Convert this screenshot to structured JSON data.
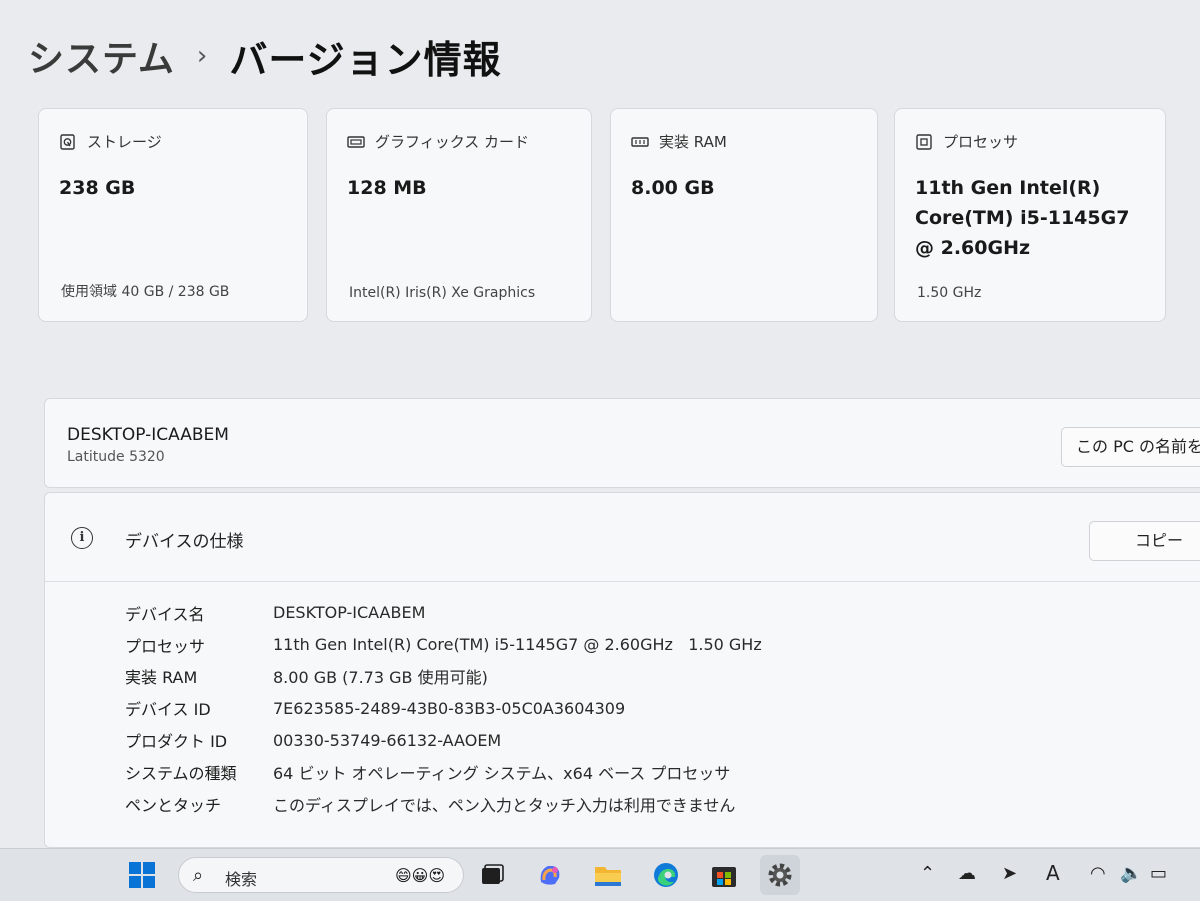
{
  "breadcrumb": {
    "parent": "システム",
    "separator": "›",
    "title": "バージョン情報"
  },
  "cards": [
    {
      "label": "ストレージ",
      "icon": "storage-icon",
      "value": "238 GB",
      "sub": "使用領域 40 GB / 238 GB"
    },
    {
      "label": "グラフィックス カード",
      "icon": "gpu-icon",
      "value": "128 MB",
      "sub": "Intel(R) Iris(R) Xe Graphics"
    },
    {
      "label": "実装 RAM",
      "icon": "ram-icon",
      "value": "8.00 GB",
      "sub": ""
    },
    {
      "label": "プロセッサ",
      "icon": "processor-icon",
      "value": "11th Gen Intel(R) Core(TM) i5-1145G7 @ 2.60GHz",
      "sub": "1.50 GHz"
    }
  ],
  "device": {
    "name": "DESKTOP-ICAABEM",
    "model": "Latitude 5320",
    "rename_label": "この PC の名前を"
  },
  "specs": {
    "title": "デバイスの仕様",
    "copy_label": "コピー",
    "rows": [
      {
        "key": "デバイス名",
        "value": "DESKTOP-ICAABEM"
      },
      {
        "key": "プロセッサ",
        "value": "11th Gen Intel(R) Core(TM) i5-1145G7 @ 2.60GHz   1.50 GHz"
      },
      {
        "key": "実装 RAM",
        "value": "8.00 GB (7.73 GB 使用可能)"
      },
      {
        "key": "デバイス ID",
        "value": "7E623585-2489-43B0-83B3-05C0A3604309"
      },
      {
        "key": "プロダクト ID",
        "value": "00330-53749-66132-AAOEM"
      },
      {
        "key": "システムの種類",
        "value": "64 ビット オペレーティング システム、x64 ベース プロセッサ"
      },
      {
        "key": "ペンとタッチ",
        "value": "このディスプレイでは、ペン入力とタッチ入力は利用できません"
      }
    ]
  },
  "taskbar": {
    "search_placeholder": "検索",
    "apps": [
      "start-icon",
      "task-view-icon",
      "copilot-icon",
      "file-explorer-icon",
      "edge-icon",
      "store-icon",
      "settings-icon"
    ],
    "tray": [
      "chevron-up-icon",
      "cloud-icon",
      "location-icon",
      "ime-indicator",
      "wifi-icon",
      "volume-icon",
      "battery-icon"
    ],
    "ime": "A"
  },
  "colors": {
    "background": "#e9ebee",
    "card": "#f7f8f9",
    "taskbar": "#dfe3e8",
    "accent": "#0067c0"
  }
}
